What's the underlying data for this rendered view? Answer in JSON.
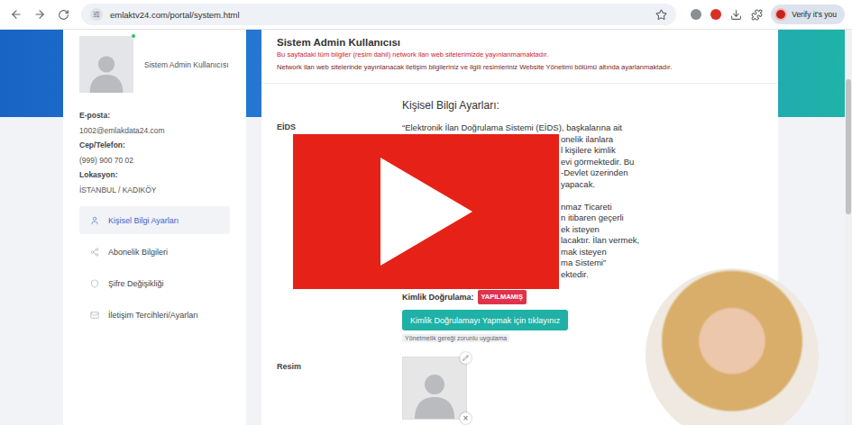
{
  "browser": {
    "url": "emlaktv24.com/portal/system.html",
    "profile_button": "Verify it's you"
  },
  "sidebar": {
    "user_name": "Sistem Admin Kullanıcısı",
    "online": true,
    "fields": [
      {
        "label": "E-posta:",
        "value": "1002@emlakdata24.com"
      },
      {
        "label": "Cep/Telefon:",
        "value": "(999) 900 70 02"
      },
      {
        "label": "Lokasyon:",
        "value": "İSTANBUL / KADIKÖY"
      }
    ],
    "menu": [
      {
        "label": "Kişisel Bilgi Ayarları",
        "selected": true
      },
      {
        "label": "Abonelik Bilgileri",
        "selected": false
      },
      {
        "label": "Şifre Değişikliği",
        "selected": false
      },
      {
        "label": "İletişim Tercihleri/Ayarları",
        "selected": false
      }
    ]
  },
  "header": {
    "title": "Sistem Admin Kullanıcısı",
    "notes": [
      {
        "text": "Bu sayfadaki tüm bilgiler (resim dahil) network ilan web sitelerimizde yayınlanmamaktadır.",
        "color": "#d0202e"
      },
      {
        "text": "Network ilan web sitelerinde yayınlanacak iletişim bilgileriniz ve ilgili resimleriniz Website Yönetimi bölümü altında ayarlanmaktadır.",
        "color": "#7a1e1e"
      }
    ]
  },
  "personal_settings": {
    "title": "Kişisel Bilgi Ayarları:",
    "eids_label": "EİDS",
    "paragraph_lines": [
      {
        "text": "“Elektronik İlan Doğrulama Sistemi (EİDS), başkalarına ait",
        "covered": false
      },
      {
        "text": "onelik ilanlara",
        "covered": true
      },
      {
        "text": "l kişilere kimlik",
        "covered": true
      },
      {
        "text": "evi görmektedir. Bu",
        "covered": true
      },
      {
        "text": "-Devlet üzerinden",
        "covered": true
      },
      {
        "text": "yapacak.",
        "covered": true
      },
      {
        "text": "",
        "covered": true
      },
      {
        "text": "nmaz Ticareti",
        "covered": true
      },
      {
        "text": "n itibaren geçerli",
        "covered": true
      },
      {
        "text": "ek isteyen",
        "covered": true
      },
      {
        "text": "lacaktır. İlan vermek,",
        "covered": true
      },
      {
        "text": "mak isteyen",
        "covered": true
      },
      {
        "text": "ma Sistemi”",
        "covered": true
      },
      {
        "text": "ektedir.",
        "covered": true
      }
    ],
    "verification_label": "Kimlik Doğrulama:",
    "verification_status": "YAPILMAMIŞ",
    "verified": false,
    "verify_button": "Kimlik Doğrulamayı Yapmak için tıklayınız",
    "verify_note": "Yönetmelik gereği zorunlu uygulama"
  },
  "picture": {
    "label": "Resim",
    "remove_icon": "×"
  }
}
